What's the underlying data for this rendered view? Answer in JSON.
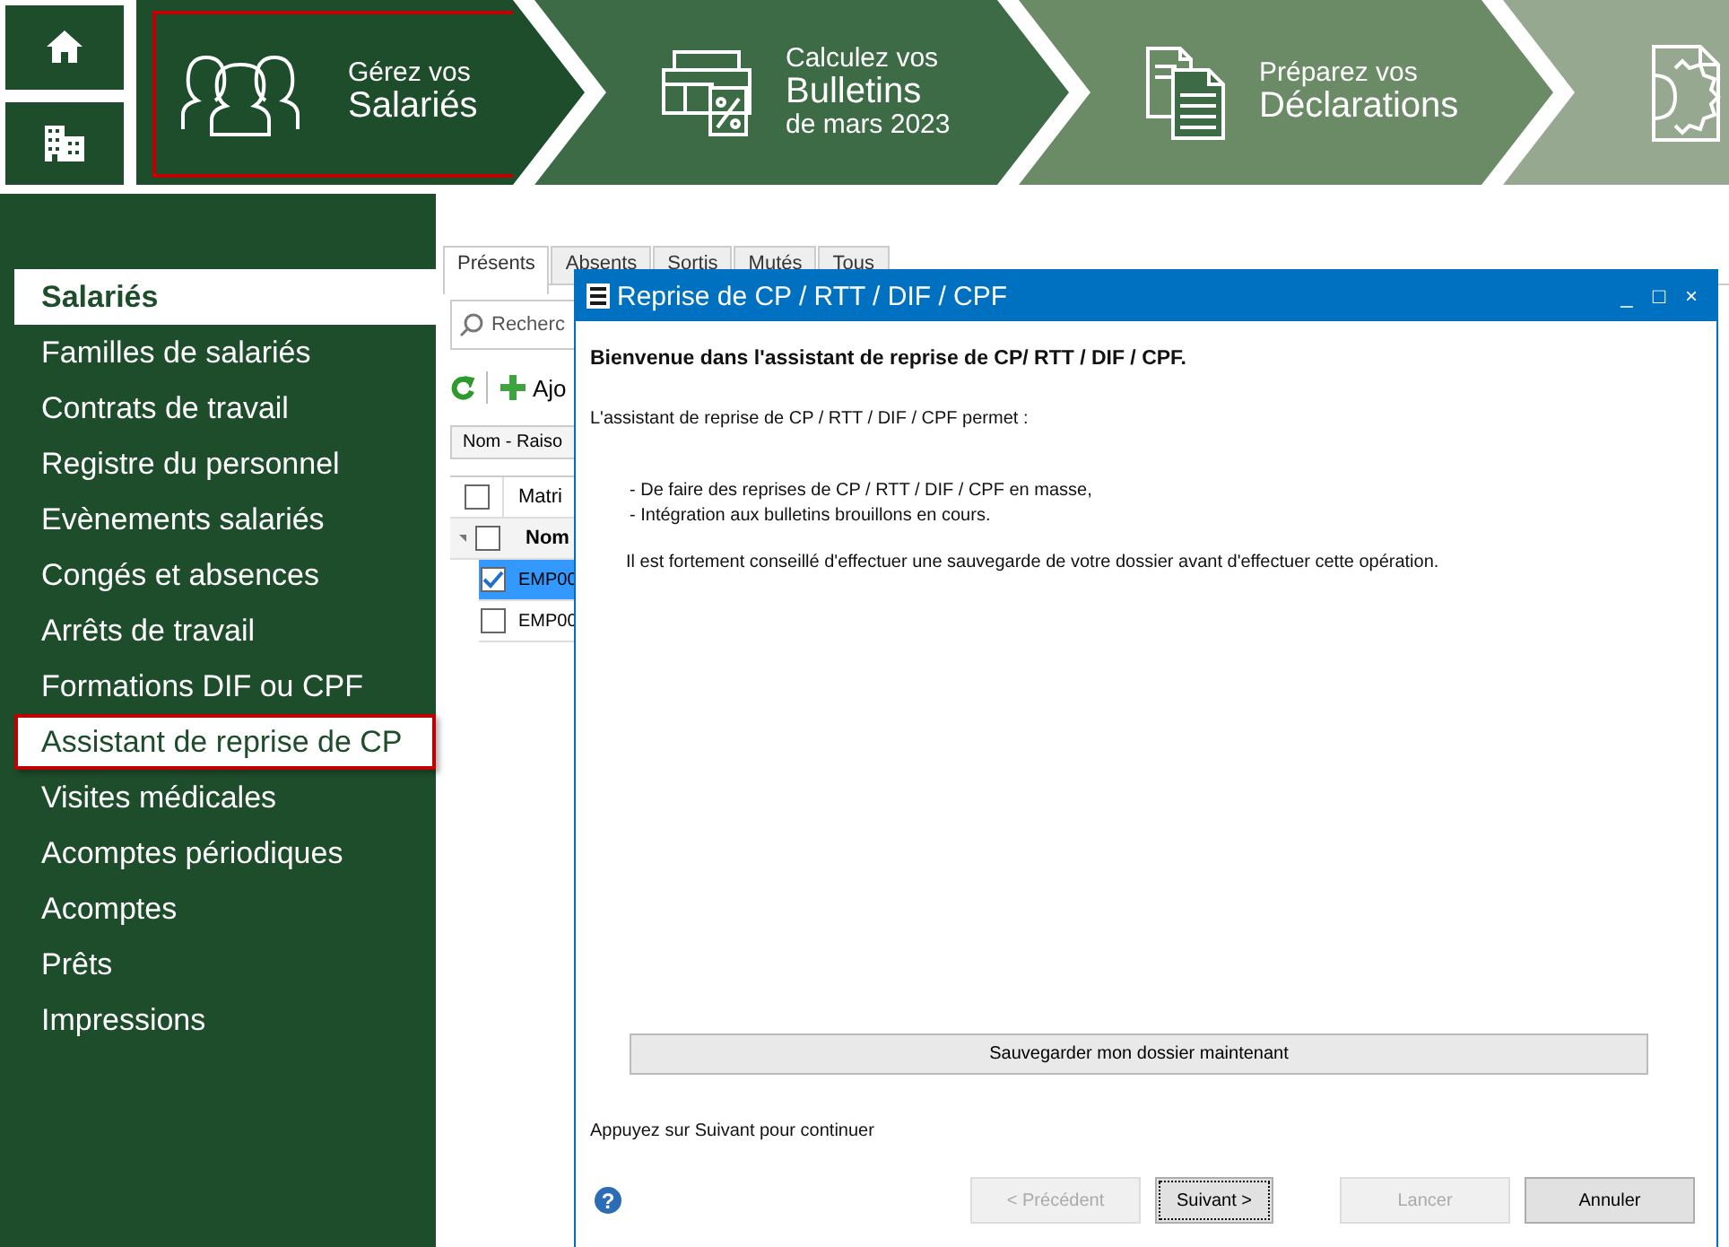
{
  "home_buttons": [
    {
      "kind": "home"
    },
    {
      "kind": "company"
    }
  ],
  "steps": [
    {
      "kind": "people",
      "line_1": "Gérez vos",
      "line_2": "Salariés",
      "selected": true
    },
    {
      "kind": "payslip",
      "line_1": "Calculez vos",
      "line_2": "Bulletins",
      "line_3": "de mars 2023",
      "selected": false
    },
    {
      "kind": "documents",
      "line_1": "Préparez vos",
      "line_2": "Déclarations",
      "selected": false
    },
    {
      "kind": "settings",
      "selected": false
    }
  ],
  "sidebar": {
    "items": [
      {
        "label": "Salariés",
        "selected": true,
        "highlighted": false
      },
      {
        "label": "Familles de salariés",
        "selected": false,
        "highlighted": false
      },
      {
        "label": "Contrats de travail",
        "selected": false,
        "highlighted": false
      },
      {
        "label": "Registre du personnel",
        "selected": false,
        "highlighted": false
      },
      {
        "label": "Evènements salariés",
        "selected": false,
        "highlighted": false
      },
      {
        "label": "Congés et absences",
        "selected": false,
        "highlighted": false
      },
      {
        "label": "Arrêts de travail",
        "selected": false,
        "highlighted": false
      },
      {
        "label": "Formations DIF ou CPF",
        "selected": false,
        "highlighted": false
      },
      {
        "label": "Assistant de reprise de CP",
        "selected": false,
        "highlighted": true
      },
      {
        "label": "Visites médicales",
        "selected": false,
        "highlighted": false
      },
      {
        "label": "Acomptes périodiques",
        "selected": false,
        "highlighted": false
      },
      {
        "label": "Acomptes",
        "selected": false,
        "highlighted": false
      },
      {
        "label": "Prêts",
        "selected": false,
        "highlighted": false
      },
      {
        "label": "Impressions",
        "selected": false,
        "highlighted": false
      }
    ]
  },
  "employees": {
    "tabs": [
      {
        "label": "Présents",
        "selected": true
      },
      {
        "label": "Absents",
        "selected": false
      },
      {
        "label": "Sortis",
        "selected": false
      },
      {
        "label": "Mutés",
        "selected": false
      },
      {
        "label": "Tous",
        "selected": false
      }
    ],
    "search": {
      "placeholder": "Recherc"
    },
    "add_button": "Ajo",
    "sort_button": "Nom - Raiso",
    "header_checked": false,
    "columns": [
      "Matri"
    ],
    "group": {
      "label": "Nom",
      "expanded": true,
      "checked": false
    },
    "rows": [
      {
        "cell": "EMP00",
        "checked": true,
        "selected": true
      },
      {
        "cell": "EMP00",
        "checked": false,
        "selected": false
      }
    ]
  },
  "dialog": {
    "title": "Reprise de CP / RTT / DIF / CPF",
    "controls": [
      "_",
      "□",
      "×"
    ],
    "heading": "Bienvenue dans l'assistant de reprise de CP/ RTT / DIF / CPF.",
    "intro": "L'assistant de reprise de CP / RTT / DIF / CPF permet :",
    "bullets": [
      "- De faire des reprises de CP / RTT / DIF / CPF en masse,",
      "- Intégration aux bulletins brouillons en cours."
    ],
    "warning": "Il est fortement conseillé d'effectuer une sauvegarde de votre dossier avant d'effectuer cette opération.",
    "save_button": "Sauvegarder mon dossier maintenant",
    "hint": "Appuyez sur Suivant pour continuer",
    "help": "?",
    "buttons": [
      {
        "label": "< Précédent",
        "disabled": true,
        "focused": false
      },
      {
        "label": "Suivant >",
        "disabled": false,
        "focused": true
      },
      {
        "label": "Lancer",
        "disabled": true,
        "focused": false
      },
      {
        "label": "Annuler",
        "disabled": false,
        "focused": false
      }
    ]
  }
}
